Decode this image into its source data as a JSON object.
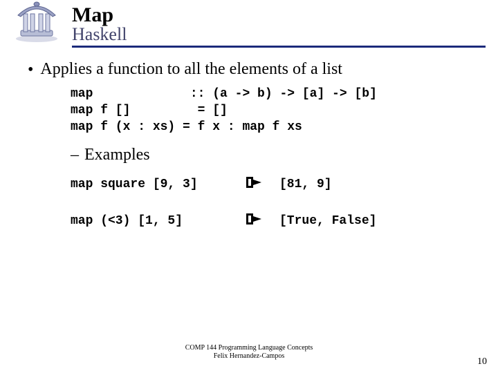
{
  "header": {
    "title": "Map",
    "subtitle": "Haskell"
  },
  "bullet": "Applies a function to all the elements of a list",
  "code": "map             :: (a -> b) -> [a] -> [b]\nmap f []         = []\nmap f (x : xs) = f x : map f xs",
  "sub_heading": "Examples",
  "examples": [
    {
      "input": "map square [9, 3]",
      "output": "[81, 9]"
    },
    {
      "input": "map (<3) [1, 5]",
      "output": "[True, False]"
    }
  ],
  "footer": {
    "line1": "COMP 144 Programming Language Concepts",
    "line2": "Felix Hernandez-Campos"
  },
  "page_number": "10"
}
